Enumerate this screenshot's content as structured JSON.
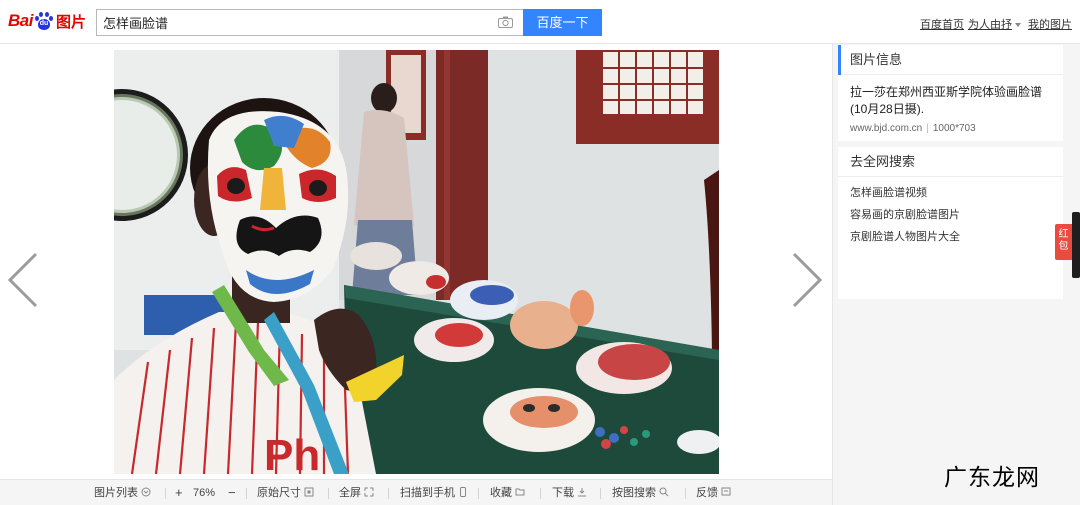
{
  "header": {
    "logo_text": "Bai",
    "logo_du": "du",
    "logo_pic": "图片",
    "search_value": "怎样画脸谱",
    "search_button": "百度一下",
    "links": {
      "home": "百度首页",
      "for_you": "为人由抒",
      "my_pics": "我的图片"
    }
  },
  "sidebar": {
    "image_info": {
      "title": "图片信息",
      "description": "拉一莎在郑州西亚斯学院体验画脸谱(10月28日摄).",
      "source": "www.bjd.com.cn",
      "separator": "|",
      "dimensions": "1000*703"
    },
    "web_search": {
      "title": "去全网搜索",
      "items": [
        "怎样画脸谱视频",
        "容易画的京剧脸谱图片",
        "京剧脸谱人物图片大全"
      ]
    },
    "red_tag": "红包"
  },
  "toolbar": {
    "list": "图片列表",
    "zoom_in": "+",
    "zoom": "76%",
    "zoom_out": "−",
    "original": "原始尺寸",
    "fullscreen": "全屏",
    "scan": "扫描到手机",
    "collect": "收藏",
    "download": "下载",
    "search_by_image": "按图搜索",
    "feedback": "反馈"
  },
  "watermark": "广东龙网",
  "colors": {
    "accent": "#3385ff",
    "brand_red": "#e10601",
    "brand_blue": "#2932e1"
  }
}
